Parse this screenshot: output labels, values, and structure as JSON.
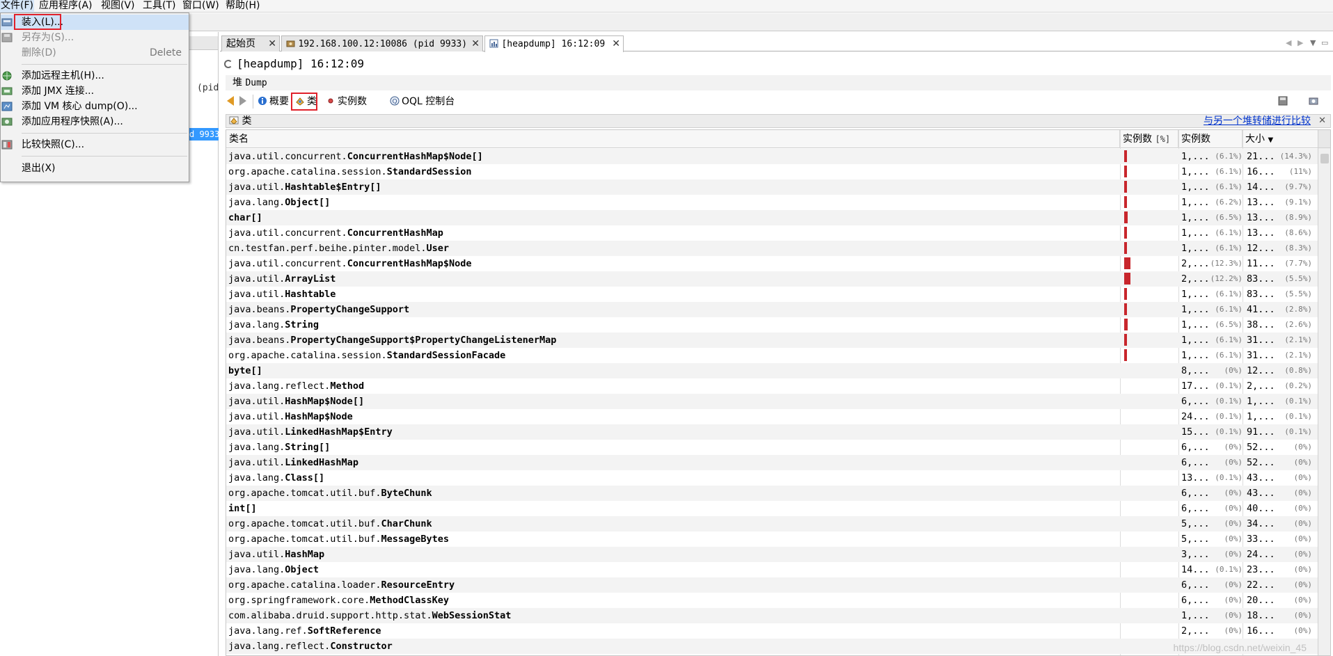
{
  "menubar": {
    "items": [
      "文件(F)",
      "应用程序(A)",
      "视图(V)",
      "工具(T)",
      "窗口(W)",
      "帮助(H)"
    ]
  },
  "file_menu": {
    "items": [
      {
        "label": "装入(L)...",
        "accel": "",
        "enabled": true,
        "icon": "load-icon"
      },
      {
        "label": "另存为(S)...",
        "accel": "",
        "enabled": false,
        "icon": "save-as-icon"
      },
      {
        "label": "删除(D)",
        "accel": "Delete",
        "enabled": false,
        "icon": ""
      },
      {
        "label": "添加远程主机(H)...",
        "accel": "",
        "enabled": true,
        "icon": "remote-host-icon"
      },
      {
        "label": "添加 JMX 连接...",
        "accel": "",
        "enabled": true,
        "icon": "jmx-icon"
      },
      {
        "label": "添加 VM 核心 dump(O)...",
        "accel": "",
        "enabled": true,
        "icon": "core-dump-icon"
      },
      {
        "label": "添加应用程序快照(A)...",
        "accel": "",
        "enabled": true,
        "icon": "snapshot-icon"
      },
      {
        "label": "比较快照(C)...",
        "accel": "",
        "enabled": true,
        "icon": "compare-icon"
      },
      {
        "label": "退出(X)",
        "accel": "",
        "enabled": true,
        "icon": ""
      }
    ]
  },
  "left_panel": {
    "pid_fragment": "(pid",
    "pid_selected": "d 9933"
  },
  "tabs": [
    {
      "label": "起始页"
    },
    {
      "label": "192.168.100.12:10086 (pid 9933)"
    },
    {
      "label": "[heapdump] 16:12:09"
    }
  ],
  "document": {
    "title": "[heapdump] 16:12:09",
    "subtitle_cn": "堆",
    "subtitle_en": "Dump"
  },
  "view_buttons": {
    "summary": "概要",
    "classes": "类",
    "instances": "实例数",
    "oql": "OQL 控制台"
  },
  "class_bar": {
    "title": "类",
    "compare_link": "与另一个堆转储进行比较"
  },
  "table": {
    "columns": {
      "name": "类名",
      "instances_pct": "实例数",
      "instances_pct_unit": "[%]",
      "instances": "实例数",
      "size": "大小"
    },
    "rows": [
      {
        "pkg": "java.util.concurrent.",
        "cls": "ConcurrentHashMap$Node[]",
        "bar": 6.1,
        "cnt": "1,...",
        "cnt_pct": "(6.1%)",
        "size": "21...",
        "size_pct": "(14.3%)"
      },
      {
        "pkg": "org.apache.catalina.session.",
        "cls": "StandardSession",
        "bar": 6.1,
        "cnt": "1,...",
        "cnt_pct": "(6.1%)",
        "size": "16...",
        "size_pct": "(11%)"
      },
      {
        "pkg": "java.util.",
        "cls": "Hashtable$Entry[]",
        "bar": 6.1,
        "cnt": "1,...",
        "cnt_pct": "(6.1%)",
        "size": "14...",
        "size_pct": "(9.7%)"
      },
      {
        "pkg": "java.lang.",
        "cls": "Object[]",
        "bar": 6.2,
        "cnt": "1,...",
        "cnt_pct": "(6.2%)",
        "size": "13...",
        "size_pct": "(9.1%)"
      },
      {
        "pkg": "",
        "cls": "char[]",
        "bar": 6.5,
        "cnt": "1,...",
        "cnt_pct": "(6.5%)",
        "size": "13...",
        "size_pct": "(8.9%)"
      },
      {
        "pkg": "java.util.concurrent.",
        "cls": "ConcurrentHashMap",
        "bar": 6.1,
        "cnt": "1,...",
        "cnt_pct": "(6.1%)",
        "size": "13...",
        "size_pct": "(8.6%)"
      },
      {
        "pkg": "cn.testfan.perf.beihe.pinter.model.",
        "cls": "User",
        "bar": 6.1,
        "cnt": "1,...",
        "cnt_pct": "(6.1%)",
        "size": "12...",
        "size_pct": "(8.3%)"
      },
      {
        "pkg": "java.util.concurrent.",
        "cls": "ConcurrentHashMap$Node",
        "bar": 12.3,
        "cnt": "2,...",
        "cnt_pct": "(12.3%)",
        "size": "11...",
        "size_pct": "(7.7%)"
      },
      {
        "pkg": "java.util.",
        "cls": "ArrayList",
        "bar": 12.2,
        "cnt": "2,...",
        "cnt_pct": "(12.2%)",
        "size": "83...",
        "size_pct": "(5.5%)"
      },
      {
        "pkg": "java.util.",
        "cls": "Hashtable",
        "bar": 6.1,
        "cnt": "1,...",
        "cnt_pct": "(6.1%)",
        "size": "83...",
        "size_pct": "(5.5%)"
      },
      {
        "pkg": "java.beans.",
        "cls": "PropertyChangeSupport",
        "bar": 6.1,
        "cnt": "1,...",
        "cnt_pct": "(6.1%)",
        "size": "41...",
        "size_pct": "(2.8%)"
      },
      {
        "pkg": "java.lang.",
        "cls": "String",
        "bar": 6.5,
        "cnt": "1,...",
        "cnt_pct": "(6.5%)",
        "size": "38...",
        "size_pct": "(2.6%)"
      },
      {
        "pkg": "java.beans.",
        "cls": "PropertyChangeSupport$PropertyChangeListenerMap",
        "bar": 6.1,
        "cnt": "1,...",
        "cnt_pct": "(6.1%)",
        "size": "31...",
        "size_pct": "(2.1%)"
      },
      {
        "pkg": "org.apache.catalina.session.",
        "cls": "StandardSessionFacade",
        "bar": 6.1,
        "cnt": "1,...",
        "cnt_pct": "(6.1%)",
        "size": "31...",
        "size_pct": "(2.1%)"
      },
      {
        "pkg": "",
        "cls": "byte[]",
        "bar": 0,
        "cnt": "8,...",
        "cnt_pct": "(0%)",
        "size": "12...",
        "size_pct": "(0.8%)"
      },
      {
        "pkg": "java.lang.reflect.",
        "cls": "Method",
        "bar": 0.1,
        "cnt": "17...",
        "cnt_pct": "(0.1%)",
        "size": "2,...",
        "size_pct": "(0.2%)"
      },
      {
        "pkg": "java.util.",
        "cls": "HashMap$Node[]",
        "bar": 0.1,
        "cnt": "6,...",
        "cnt_pct": "(0.1%)",
        "size": "1,...",
        "size_pct": "(0.1%)"
      },
      {
        "pkg": "java.util.",
        "cls": "HashMap$Node",
        "bar": 0.1,
        "cnt": "24...",
        "cnt_pct": "(0.1%)",
        "size": "1,...",
        "size_pct": "(0.1%)"
      },
      {
        "pkg": "java.util.",
        "cls": "LinkedHashMap$Entry",
        "bar": 0.1,
        "cnt": "15...",
        "cnt_pct": "(0.1%)",
        "size": "91...",
        "size_pct": "(0.1%)"
      },
      {
        "pkg": "java.lang.",
        "cls": "String[]",
        "bar": 0,
        "cnt": "6,...",
        "cnt_pct": "(0%)",
        "size": "52...",
        "size_pct": "(0%)"
      },
      {
        "pkg": "java.util.",
        "cls": "LinkedHashMap",
        "bar": 0,
        "cnt": "6,...",
        "cnt_pct": "(0%)",
        "size": "52...",
        "size_pct": "(0%)"
      },
      {
        "pkg": "java.lang.",
        "cls": "Class[]",
        "bar": 0.1,
        "cnt": "13...",
        "cnt_pct": "(0.1%)",
        "size": "43...",
        "size_pct": "(0%)"
      },
      {
        "pkg": "org.apache.tomcat.util.buf.",
        "cls": "ByteChunk",
        "bar": 0,
        "cnt": "6,...",
        "cnt_pct": "(0%)",
        "size": "43...",
        "size_pct": "(0%)"
      },
      {
        "pkg": "",
        "cls": "int[]",
        "bar": 0,
        "cnt": "6,...",
        "cnt_pct": "(0%)",
        "size": "40...",
        "size_pct": "(0%)"
      },
      {
        "pkg": "org.apache.tomcat.util.buf.",
        "cls": "CharChunk",
        "bar": 0,
        "cnt": "5,...",
        "cnt_pct": "(0%)",
        "size": "34...",
        "size_pct": "(0%)"
      },
      {
        "pkg": "org.apache.tomcat.util.buf.",
        "cls": "MessageBytes",
        "bar": 0,
        "cnt": "5,...",
        "cnt_pct": "(0%)",
        "size": "33...",
        "size_pct": "(0%)"
      },
      {
        "pkg": "java.util.",
        "cls": "HashMap",
        "bar": 0,
        "cnt": "3,...",
        "cnt_pct": "(0%)",
        "size": "24...",
        "size_pct": "(0%)"
      },
      {
        "pkg": "java.lang.",
        "cls": "Object",
        "bar": 0.1,
        "cnt": "14...",
        "cnt_pct": "(0.1%)",
        "size": "23...",
        "size_pct": "(0%)"
      },
      {
        "pkg": "org.apache.catalina.loader.",
        "cls": "ResourceEntry",
        "bar": 0,
        "cnt": "6,...",
        "cnt_pct": "(0%)",
        "size": "22...",
        "size_pct": "(0%)"
      },
      {
        "pkg": "org.springframework.core.",
        "cls": "MethodClassKey",
        "bar": 0,
        "cnt": "6,...",
        "cnt_pct": "(0%)",
        "size": "20...",
        "size_pct": "(0%)"
      },
      {
        "pkg": "com.alibaba.druid.support.http.stat.",
        "cls": "WebSessionStat",
        "bar": 0,
        "cnt": "1,...",
        "cnt_pct": "(0%)",
        "size": "18...",
        "size_pct": "(0%)"
      },
      {
        "pkg": "java.lang.ref.",
        "cls": "SoftReference",
        "bar": 0,
        "cnt": "2,...",
        "cnt_pct": "(0%)",
        "size": "16...",
        "size_pct": "(0%)"
      },
      {
        "pkg": "java.lang.reflect.",
        "cls": "Constructor",
        "bar": 0,
        "cnt": "",
        "cnt_pct": "",
        "size": "",
        "size_pct": ""
      }
    ]
  },
  "watermark": "https://blog.csdn.net/weixin_45",
  "colors": {
    "bar": "#c8262c",
    "highlight_box": "#e0202a",
    "link": "#0033cc"
  }
}
